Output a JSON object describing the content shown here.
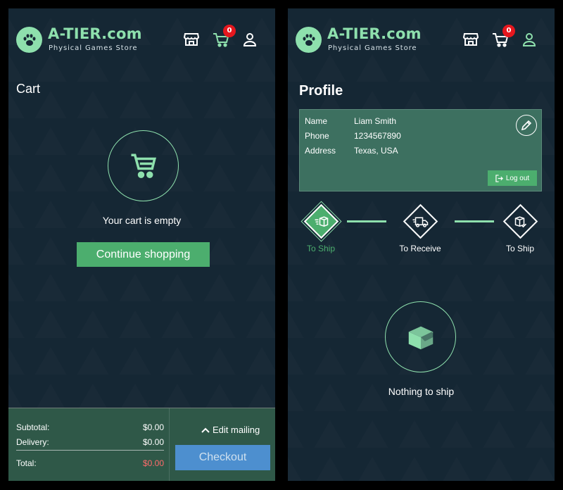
{
  "brand": {
    "name": "A-TIER.com",
    "tagline": "Physical Games Store"
  },
  "colors": {
    "background": "#152734",
    "accent": "#8ee0ad",
    "button_green": "#4cae6e",
    "badge_red": "#e5171e",
    "checkout_blue": "#4d8fcf",
    "panel": "#2f5848"
  },
  "header": {
    "cart_count": "0",
    "icons": [
      "store-icon",
      "cart-icon",
      "user-icon"
    ]
  },
  "cart": {
    "title": "Cart",
    "empty_text": "Your cart is empty",
    "continue_label": "Continue shopping",
    "summary": {
      "subtotal_label": "Subtotal:",
      "subtotal_value": "$0.00",
      "delivery_label": "Delivery:",
      "delivery_value": "$0.00",
      "total_label": "Total:",
      "total_value": "$0.00"
    },
    "edit_mailing_label": "Edit mailing",
    "checkout_label": "Checkout"
  },
  "profile": {
    "title": "Profile",
    "fields": [
      {
        "label": "Name",
        "value": "Liam Smith"
      },
      {
        "label": "Phone",
        "value": "1234567890"
      },
      {
        "label": "Address",
        "value": "Texas, USA"
      }
    ],
    "logout_label": "Log out",
    "steps": [
      {
        "label": "To Ship",
        "active": true,
        "icon": "box-speed-icon"
      },
      {
        "label": "To Receive",
        "active": false,
        "icon": "truck-icon"
      },
      {
        "label": "To Ship",
        "active": false,
        "icon": "box-check-icon"
      }
    ],
    "empty_text": "Nothing to ship"
  }
}
